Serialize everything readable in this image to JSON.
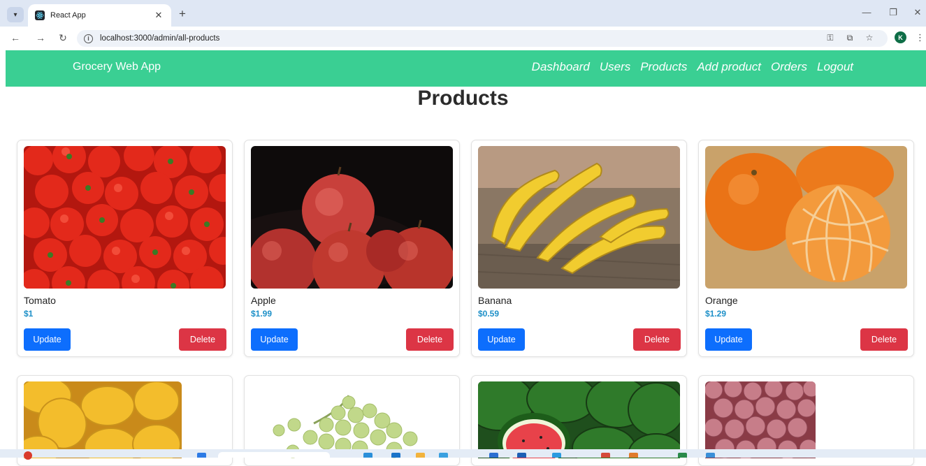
{
  "browser": {
    "tab_title": "React App",
    "url": "localhost:3000/admin/all-products",
    "profile_initial": "K",
    "icons": {
      "tab_menu": "chevron-down-icon",
      "close_tab": "close-icon",
      "new_tab": "plus-icon",
      "back": "arrow-left-icon",
      "forward": "arrow-right-icon",
      "reload": "reload-icon",
      "site_info": "info-icon",
      "password": "key-icon",
      "cast": "cast-icon",
      "bookmark": "star-icon",
      "menu": "kebab-icon",
      "minimize": "minimize-icon",
      "restore": "restore-icon",
      "close_window": "close-icon"
    }
  },
  "navbar": {
    "brand": "Grocery Web App",
    "links": [
      "Dashboard",
      "Users",
      "Products",
      "Add product",
      "Orders",
      "Logout"
    ],
    "color": "#3acf93"
  },
  "page": {
    "title": "Products"
  },
  "products": [
    {
      "name": "Tomato",
      "price": "$1",
      "image": "tomatoes"
    },
    {
      "name": "Apple",
      "price": "$1.99",
      "image": "apples"
    },
    {
      "name": "Banana",
      "price": "$0.59",
      "image": "bananas"
    },
    {
      "name": "Orange",
      "price": "$1.29",
      "image": "oranges"
    }
  ],
  "products_row2_images": [
    "mangoes",
    "grapes",
    "watermelons",
    "onions"
  ],
  "buttons": {
    "update_label": "Update",
    "delete_label": "Delete",
    "update_color": "#0d6efd",
    "delete_color": "#dc3545"
  },
  "price_color": "#1e90c8"
}
